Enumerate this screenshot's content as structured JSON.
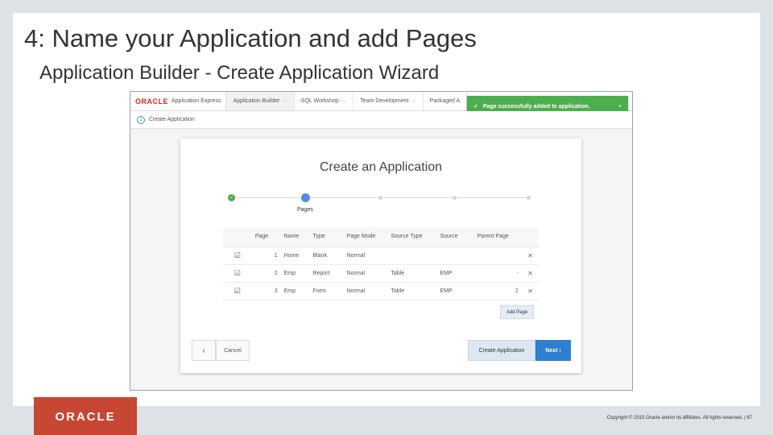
{
  "slide": {
    "title": "4: Name your Application and add Pages",
    "subtitle": "Application Builder - Create Application Wizard",
    "footer_copyright": "Copyright © 2015 Oracle and/or its affiliates. All rights reserved. | 67",
    "logo_text": "ORACLE"
  },
  "apex": {
    "brand": "ORACLE",
    "product": "Application Express",
    "tabs": [
      {
        "label": "Application Builder"
      },
      {
        "label": "SQL Workshop"
      },
      {
        "label": "Team Development"
      },
      {
        "label": "Packaged A"
      }
    ],
    "toast": "Page successfully added to application.",
    "toast_close": "×",
    "breadcrumb_step": "1",
    "breadcrumb_label": "Create Application"
  },
  "wizard": {
    "title": "Create an Application",
    "current_step_label": "Pages",
    "columns": [
      "Page",
      "Name",
      "Type",
      "Page Mode",
      "Source Type",
      "Source",
      "Parent Page"
    ],
    "rows": [
      {
        "page": "1",
        "name": "Home",
        "type": "Blank",
        "mode": "Normal",
        "source_type": "",
        "source": "",
        "parent": ""
      },
      {
        "page": "2",
        "name": "Emp",
        "type": "Report",
        "mode": "Normal",
        "source_type": "Table",
        "source": "EMP",
        "parent": "-"
      },
      {
        "page": "3",
        "name": "Emp",
        "type": "Form",
        "mode": "Normal",
        "source_type": "Table",
        "source": "EMP",
        "parent": "2"
      }
    ],
    "add_page": "Add Page",
    "back": "‹",
    "cancel": "Cancel",
    "create": "Create Application",
    "next": "Next ›"
  },
  "colors": {
    "oracle_red": "#c74634",
    "success_green": "#4cae4c",
    "primary_blue": "#2e7fd0"
  }
}
